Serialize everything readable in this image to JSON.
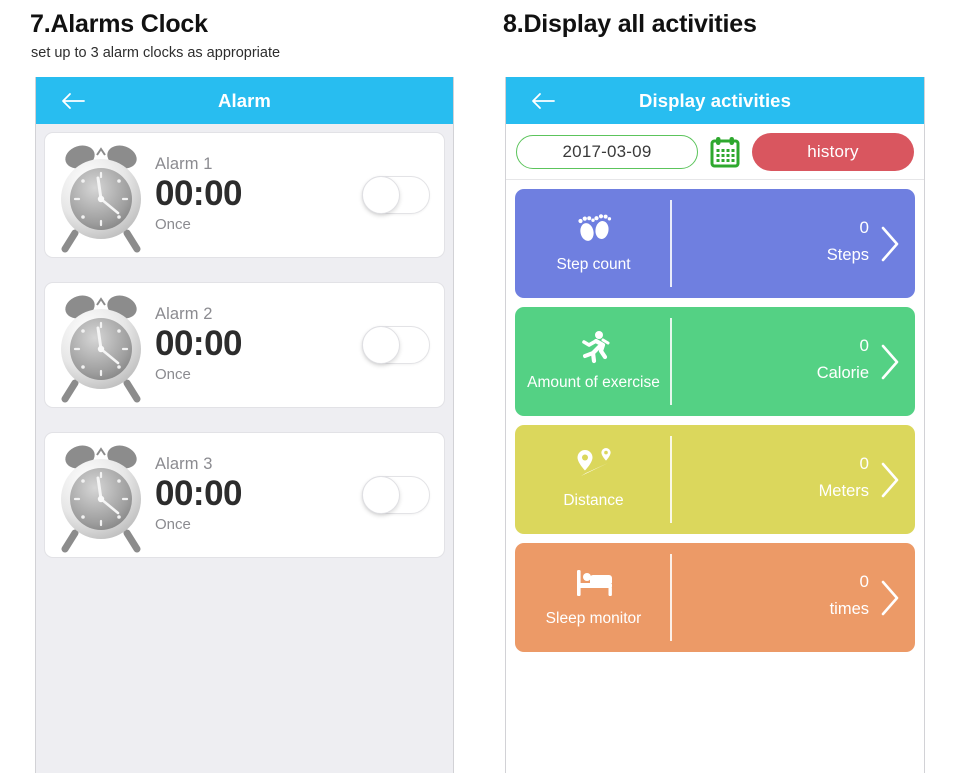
{
  "sections": [
    {
      "heading": "7.Alarms Clock",
      "subheading": "set up to 3 alarm clocks as appropriate"
    },
    {
      "heading": "8.Display all activities",
      "subheading": ""
    }
  ],
  "alarm_screen": {
    "appbar": {
      "title": "Alarm",
      "back_icon": "back-arrow-icon"
    },
    "alarms": [
      {
        "name": "Alarm 1",
        "time": "00:00",
        "repeat": "Once",
        "enabled": false,
        "icon": "alarm-clock-icon"
      },
      {
        "name": "Alarm 2",
        "time": "00:00",
        "repeat": "Once",
        "enabled": false,
        "icon": "alarm-clock-icon"
      },
      {
        "name": "Alarm 3",
        "time": "00:00",
        "repeat": "Once",
        "enabled": false,
        "icon": "alarm-clock-icon"
      }
    ]
  },
  "activities_screen": {
    "appbar": {
      "title": "Display activities",
      "back_icon": "back-arrow-icon"
    },
    "toolbar": {
      "date_value": "2017-03-09",
      "date_placeholder": "2017-03-09",
      "calendar_icon": "calendar-icon",
      "history_label": "history"
    },
    "cards": [
      {
        "label": "Step count",
        "value": "0",
        "unit": "Steps",
        "color": "#6f7fe0",
        "icon": "footprints-icon"
      },
      {
        "label": "Amount of exercise",
        "value": "0",
        "unit": "Calorie",
        "color": "#54d184",
        "icon": "running-person-icon"
      },
      {
        "label": "Distance",
        "value": "0",
        "unit": "Meters",
        "color": "#dbd75c",
        "icon": "route-pins-icon"
      },
      {
        "label": "Sleep monitor",
        "value": "0",
        "unit": "times",
        "color": "#ec9a67",
        "icon": "bed-icon"
      }
    ]
  },
  "colors": {
    "appbar_blue": "#28bdf0",
    "date_border_green": "#5cc45c",
    "history_red": "#d9565f",
    "screen_bg_gray": "#eeeef2"
  }
}
